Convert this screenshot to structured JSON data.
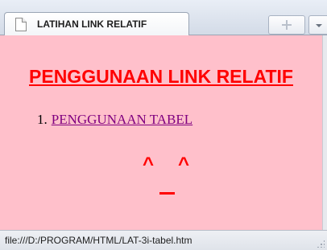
{
  "tab": {
    "title": "LATIHAN LINK RELATIF",
    "icon": "page-icon"
  },
  "toolbar": {
    "new_tab_icon": "plus-icon",
    "tab_menu_icon": "chevron-down-icon"
  },
  "page": {
    "heading": "PENGGUNAAN LINK RELATIF",
    "list": [
      {
        "number": "1.",
        "label": "PENGGUNAAN TABEL"
      }
    ],
    "emoticon": {
      "left_eye": "^",
      "right_eye": "^"
    },
    "colors": {
      "background": "#ffc0cb",
      "heading": "#ff0000",
      "link": "#800080"
    }
  },
  "statusbar": {
    "text": "file:///D:/PROGRAM/HTML/LAT-3i-tabel.htm"
  }
}
